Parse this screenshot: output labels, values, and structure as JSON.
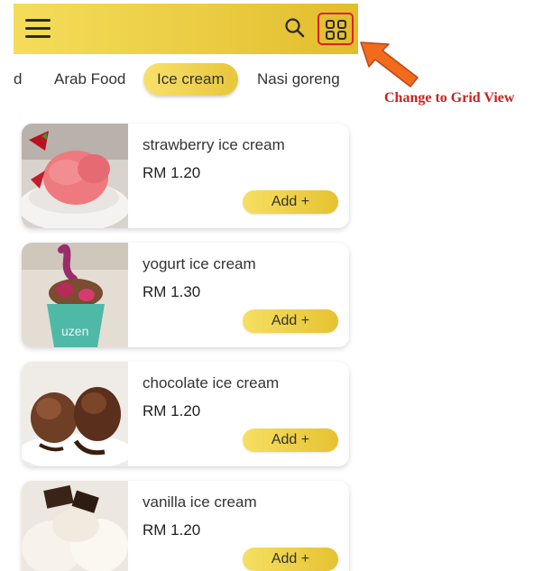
{
  "header": {
    "menu_icon": "hamburger-menu-icon",
    "search_icon": "search-icon",
    "grid_icon": "grid-view-icon",
    "highlight_color": "#e0201c",
    "bar_gradient": [
      "#f4dd5a",
      "#e2bd2c"
    ]
  },
  "categories": [
    {
      "label": "d",
      "active": false
    },
    {
      "label": "Arab Food",
      "active": false
    },
    {
      "label": "Ice cream",
      "active": true
    },
    {
      "label": "Nasi goreng",
      "active": false
    }
  ],
  "items": [
    {
      "name": "strawberry ice cream",
      "price": "RM 1.20",
      "add_label": "Add +"
    },
    {
      "name": "yogurt ice cream",
      "price": "RM 1.30",
      "add_label": "Add +"
    },
    {
      "name": "chocolate ice cream",
      "price": "RM 1.20",
      "add_label": "Add +"
    },
    {
      "name": "vanilla ice cream",
      "price": "RM 1.20",
      "add_label": "Add +"
    }
  ],
  "annotation": {
    "label": "Change to Grid View",
    "color": "#c8231f",
    "arrow_color": "#f26b1d"
  }
}
